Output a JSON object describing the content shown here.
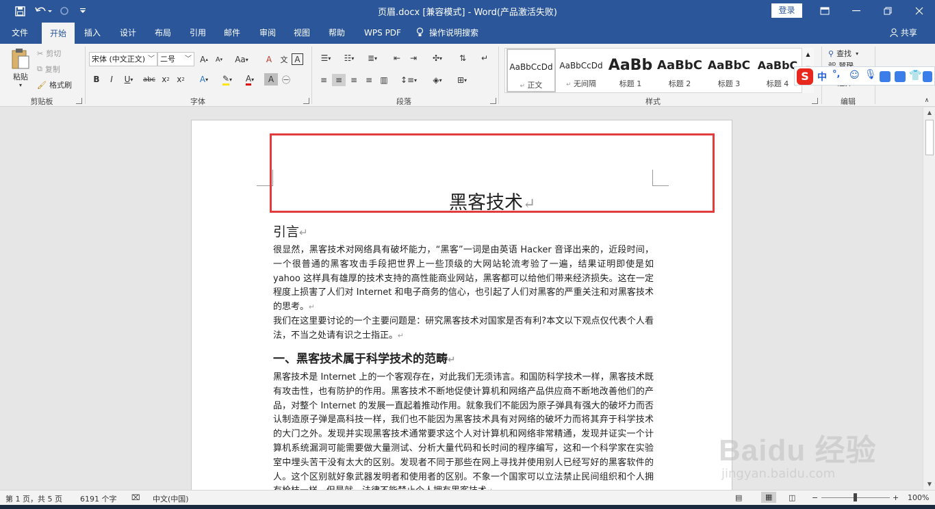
{
  "titlebar": {
    "title": "页眉.docx [兼容模式]  -  Word(产品激活失败)",
    "login": "登录"
  },
  "tabs": [
    "文件",
    "开始",
    "插入",
    "设计",
    "布局",
    "引用",
    "邮件",
    "审阅",
    "视图",
    "帮助",
    "WPS PDF",
    "操作说明搜索",
    "共享"
  ],
  "active_tab": "开始",
  "clipboard": {
    "paste": "粘贴",
    "cut": "剪切",
    "copy": "复制",
    "format_painter": "格式刷",
    "label": "剪贴板"
  },
  "font": {
    "name": "宋体 (中文正文)",
    "size": "二号",
    "change_case": "Aa",
    "label": "字体"
  },
  "paragraph": {
    "label": "段落"
  },
  "styles": {
    "label": "样式",
    "items": [
      {
        "preview": "AaBbCcDd",
        "name": "正文"
      },
      {
        "preview": "AaBbCcDd",
        "name": "无间隔"
      },
      {
        "preview": "AaBb",
        "name": "标题 1"
      },
      {
        "preview": "AaBbC",
        "name": "标题 2"
      },
      {
        "preview": "AaBbC",
        "name": "标题 3"
      },
      {
        "preview": "AaBbC",
        "name": "标题 4"
      }
    ]
  },
  "editing": {
    "find": "查找",
    "replace": "替换",
    "select": "选择",
    "label": "编辑"
  },
  "ime": {
    "logo": "S",
    "mode": "中",
    "punct": "°,"
  },
  "document": {
    "header_title": "黑客技术",
    "heading1": "引言",
    "para1": "很显然，黑客技术对网络具有破坏能力，“黑客”一词是由英语 Hacker 音译出来的，近段时间，一个很普通的黑客攻击手段把世界上一些顶级的大网站轮流考验了一遍，结果证明即使是如 yahoo 这样具有雄厚的技术支持的高性能商业网站，黑客都可以给他们带来经济损失。这在一定程度上损害了人们对 Internet 和电子商务的信心，也引起了人们对黑客的严重关注和对黑客技术的思考。",
    "para2": "我们在这里要讨论的一个主要问题是：研究黑客技术对国家是否有利?本文以下观点仅代表个人看法，不当之处请有识之士指正。",
    "heading2": "一、黑客技术属于科学技术的范畴",
    "para3": "黑客技术是 Internet 上的一个客观存在，对此我们无须讳言。和国防科学技术一样，黑客技术既有攻击性，也有防护的作用。黑客技术不断地促使计算机和网络产品供应商不断地改善他们的产品，对整个 Internet 的发展一直起着推动作用。就象我们不能因为原子弹具有强大的破坏力而否认制造原子弹是高科技一样，我们也不能因为黑客技术具有对网络的破坏力而将其弃于科学技术的大门之外。发现并实现黑客技术通常要求这个人对计算机和网络非常精通，发现并证实一个计算机系统漏洞可能需要做大量测试、分析大量代码和长时间的程序编写，这和一个科学家在实验室中埋头苦干没有太大的区别。发现者不同于那些在网上寻找并使用别人已经写好的黑客软件的人。这个区别就好象武器发明者和使用者的区别。不象一个国家可以立法禁止民间组织和个人拥有枪枝一样，但是就，法律不能禁止个人拥有黑客技术"
  },
  "paragraph_mark": "↵",
  "status": {
    "page": "第 1 页，共 5 页",
    "words": "6191 个字",
    "language": "中文(中国)",
    "zoom": "100%",
    "zoom_minus": "−",
    "zoom_plus": "+"
  },
  "watermark": {
    "brand": "Baidu 经验",
    "url": "jingyan.baidu.com"
  },
  "colors": {
    "accent": "#2b579a",
    "highlight_border": "#e23b3b",
    "ime_logo": "#e8281c"
  }
}
